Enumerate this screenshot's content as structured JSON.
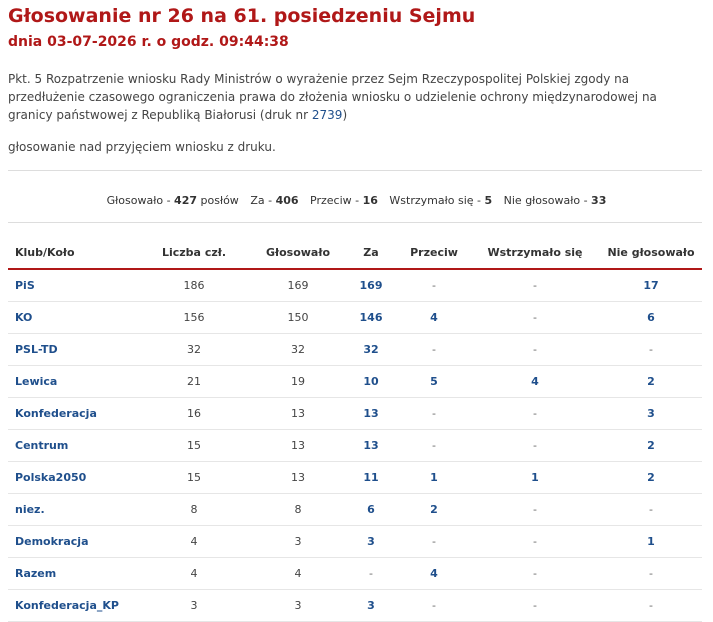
{
  "header": {
    "title": "Głosowanie nr 26 na 61. posiedzeniu Sejmu",
    "subtitle": "dnia 03-07-2026 r. o godz. 09:44:38"
  },
  "description": {
    "text_before": "Pkt. 5 Rozpatrzenie wniosku Rady Ministrów o wyrażenie przez Sejm Rzeczypospolitej Polskiej zgody na przedłużenie czasowego ograniczenia prawa do złożenia wniosku o udzielenie ochrony międzynarodowej na granicy państwowej z Republiką Białorusi (druk nr ",
    "link": "2739",
    "text_after": ")"
  },
  "mode": "głosowanie nad przyjęciem wniosku z druku.",
  "summary": {
    "voted_label": "Głosowało - ",
    "voted_value": "427",
    "voted_suffix": " posłów",
    "za_label": "Za - ",
    "za_value": "406",
    "przeciw_label": "Przeciw - ",
    "przeciw_value": "16",
    "wstrzymalo_label": "Wstrzymało się - ",
    "wstrzymalo_value": "5",
    "nie_label": "Nie głosowało - ",
    "nie_value": "33"
  },
  "table": {
    "headers": [
      "Klub/Koło",
      "Liczba czł.",
      "Głosowało",
      "Za",
      "Przeciw",
      "Wstrzymało się",
      "Nie głosowało"
    ],
    "rows": [
      [
        "PiS",
        "186",
        "169",
        "169",
        "-",
        "-",
        "17"
      ],
      [
        "KO",
        "156",
        "150",
        "146",
        "4",
        "-",
        "6"
      ],
      [
        "PSL-TD",
        "32",
        "32",
        "32",
        "-",
        "-",
        "-"
      ],
      [
        "Lewica",
        "21",
        "19",
        "10",
        "5",
        "4",
        "2"
      ],
      [
        "Konfederacja",
        "16",
        "13",
        "13",
        "-",
        "-",
        "3"
      ],
      [
        "Centrum",
        "15",
        "13",
        "13",
        "-",
        "-",
        "2"
      ],
      [
        "Polska2050",
        "15",
        "13",
        "11",
        "1",
        "1",
        "2"
      ],
      [
        "niez.",
        "8",
        "8",
        "6",
        "2",
        "-",
        "-"
      ],
      [
        "Demokracja",
        "4",
        "3",
        "3",
        "-",
        "-",
        "1"
      ],
      [
        "Razem",
        "4",
        "4",
        "-",
        "4",
        "-",
        "-"
      ],
      [
        "Konfederacja_KP",
        "3",
        "3",
        "3",
        "-",
        "-",
        "-"
      ]
    ]
  },
  "colors": {
    "accent": "#b01818",
    "link": "#1f4f8c"
  }
}
